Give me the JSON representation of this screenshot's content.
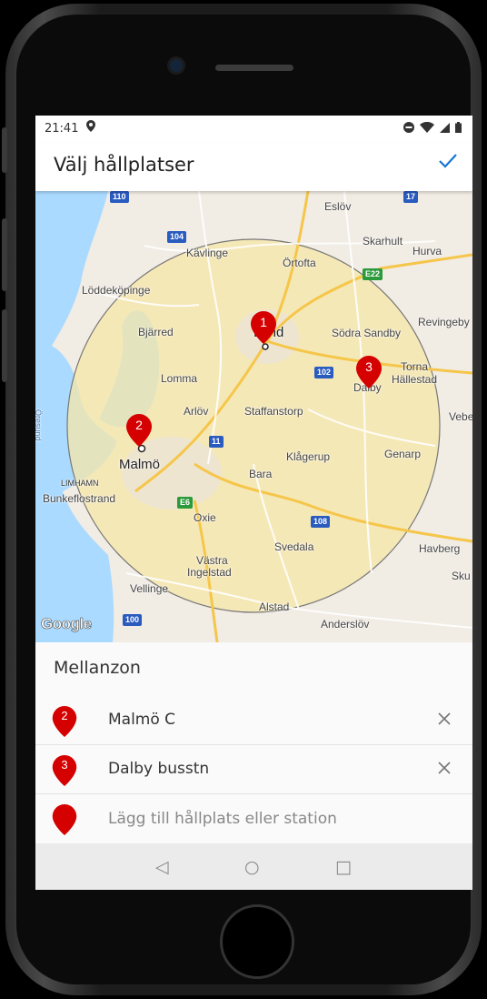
{
  "status_bar": {
    "time": "21:41"
  },
  "app_bar": {
    "title": "Välj hållplatser",
    "confirm_icon": "check-icon"
  },
  "map": {
    "labels": {
      "eslov": "Eslöv",
      "skarhult": "Skarhult",
      "hurva": "Hurva",
      "kavlinge": "Kävlinge",
      "ortofta": "Örtofta",
      "loddekopinge": "Löddeköpinge",
      "revingeby": "Revingeby",
      "bjarred": "Bjärred",
      "lund": "Lund",
      "sodra_sandby": "Södra Sandby",
      "torna": "Torna",
      "hallestad": "Hällestad",
      "lomma": "Lomma",
      "dalby": "Dalby",
      "arlov": "Arlöv",
      "staffanstorp": "Staffanstorp",
      "vebe": "Vebe",
      "malmo": "Malmö",
      "klagerup": "Klågerup",
      "genarp": "Genarp",
      "limhamn": "LIMHAMN",
      "bunkeflostrand": "Bunkeflostrand",
      "bara": "Bara",
      "oxie": "Oxie",
      "svedala": "Svedala",
      "havberg": "Havberg",
      "vastra": "Västra",
      "ingelstad": "Ingelstad",
      "sku": "Sku",
      "vellinge": "Vellinge",
      "alstad": "Alstad",
      "anderslov": "Anderslöv",
      "oresund": "Öresund"
    },
    "road_badges": {
      "r110": "110",
      "r17": "17",
      "r104": "104",
      "e22": "E22",
      "r102": "102",
      "r11": "11",
      "e6": "E6",
      "r108": "108",
      "r100": "100"
    },
    "pins": [
      {
        "number": "1"
      },
      {
        "number": "2"
      },
      {
        "number": "3"
      }
    ],
    "attribution": "Google",
    "colors": {
      "water": "#aadaff",
      "land": "#f1ece4",
      "zone_fill": "#f6e7a8",
      "pin": "#d50000",
      "highway": "#f9d76a"
    }
  },
  "zone": {
    "title": "Mellanzon"
  },
  "stops": [
    {
      "number": "2",
      "name": "Malmö C",
      "remove_icon": "close-icon"
    },
    {
      "number": "3",
      "name": "Dalby busstn",
      "remove_icon": "close-icon"
    }
  ],
  "add_stop": {
    "placeholder": "Lägg till hållplats eller station"
  },
  "nav_bar": {
    "back": "◁",
    "home": "○",
    "recents": "□"
  }
}
